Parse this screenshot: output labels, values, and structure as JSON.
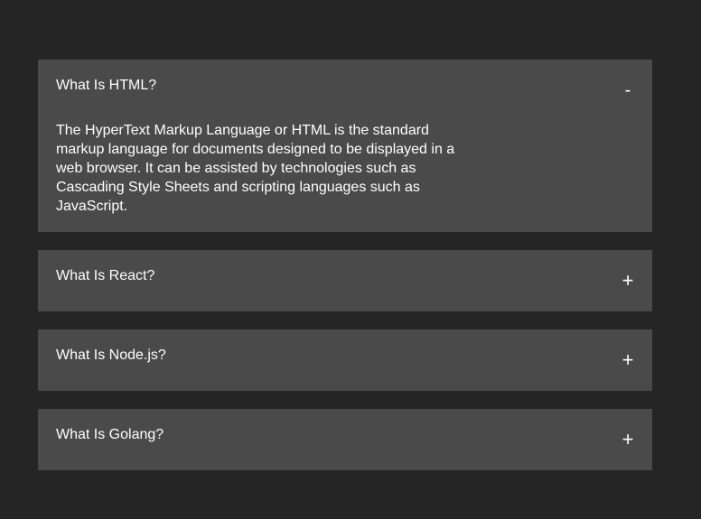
{
  "accordion": {
    "items": [
      {
        "title": "What Is HTML?",
        "toggle": "-",
        "open": true,
        "body": "The HyperText Markup Language or HTML is the standard markup language for documents designed to be displayed in a web browser. It can be assisted by technologies such as Cascading Style Sheets and scripting languages such as JavaScript."
      },
      {
        "title": "What Is React?",
        "toggle": "+",
        "open": false
      },
      {
        "title": "What Is Node.js?",
        "toggle": "+",
        "open": false
      },
      {
        "title": "What Is Golang?",
        "toggle": "+",
        "open": false
      }
    ]
  },
  "colors": {
    "background": "#252525",
    "item_background": "#4a4a4a",
    "text": "#ffffff"
  }
}
